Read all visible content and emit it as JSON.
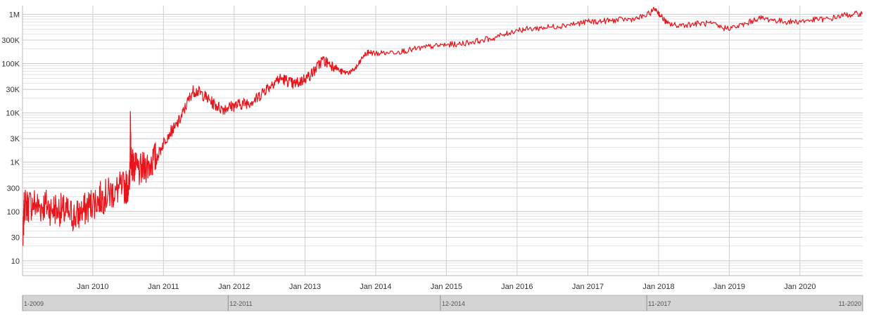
{
  "chart_data": {
    "type": "line",
    "title": "",
    "xlabel": "",
    "ylabel": "",
    "y_scale": "log",
    "ylim": [
      5,
      1500000
    ],
    "xlim": [
      "2009-01-03",
      "2020-11-20"
    ],
    "grid": true,
    "legend": "none",
    "y_ticks": [
      {
        "value": 10,
        "label": "10"
      },
      {
        "value": 30,
        "label": "30"
      },
      {
        "value": 100,
        "label": "100"
      },
      {
        "value": 300,
        "label": "300"
      },
      {
        "value": 1000,
        "label": "1K"
      },
      {
        "value": 3000,
        "label": "3K"
      },
      {
        "value": 10000,
        "label": "10K"
      },
      {
        "value": 30000,
        "label": "30K"
      },
      {
        "value": 100000,
        "label": "100K"
      },
      {
        "value": 300000,
        "label": "300K"
      },
      {
        "value": 1000000,
        "label": "1M"
      }
    ],
    "x_ticks": [
      {
        "date": "2010-01-01",
        "label": "Jan 2010"
      },
      {
        "date": "2011-01-01",
        "label": "Jan 2011"
      },
      {
        "date": "2012-01-01",
        "label": "Jan 2012"
      },
      {
        "date": "2013-01-01",
        "label": "Jan 2013"
      },
      {
        "date": "2014-01-01",
        "label": "Jan 2014"
      },
      {
        "date": "2015-01-01",
        "label": "Jan 2015"
      },
      {
        "date": "2016-01-01",
        "label": "Jan 2016"
      },
      {
        "date": "2017-01-01",
        "label": "Jan 2017"
      },
      {
        "date": "2018-01-01",
        "label": "Jan 2018"
      },
      {
        "date": "2019-01-01",
        "label": "Jan 2019"
      },
      {
        "date": "2020-01-01",
        "label": "Jan 2020"
      }
    ],
    "navigator_labels": [
      {
        "date": "2009-01-03",
        "label": "1-2009"
      },
      {
        "date": "2011-12-01",
        "label": "12-2011"
      },
      {
        "date": "2014-12-01",
        "label": "12-2014"
      },
      {
        "date": "2017-11-01",
        "label": "11-2017"
      },
      {
        "date": "2020-11-20",
        "label": "11-2020"
      }
    ],
    "series": [
      {
        "color": "#e8141b",
        "points": [
          [
            "2009-01-05",
            25
          ],
          [
            "2009-01-12",
            140
          ],
          [
            "2009-02-01",
            130
          ],
          [
            "2009-03-01",
            150
          ],
          [
            "2009-04-01",
            120
          ],
          [
            "2009-05-01",
            140
          ],
          [
            "2009-06-01",
            110
          ],
          [
            "2009-07-01",
            120
          ],
          [
            "2009-08-01",
            100
          ],
          [
            "2009-09-01",
            90
          ],
          [
            "2009-10-01",
            80
          ],
          [
            "2009-11-01",
            90
          ],
          [
            "2009-12-01",
            120
          ],
          [
            "2010-01-01",
            150
          ],
          [
            "2010-02-01",
            180
          ],
          [
            "2010-03-01",
            200
          ],
          [
            "2010-04-01",
            230
          ],
          [
            "2010-05-01",
            270
          ],
          [
            "2010-06-01",
            300
          ],
          [
            "2010-06-25",
            320
          ],
          [
            "2010-07-10",
            350
          ],
          [
            "2010-07-14",
            6000
          ],
          [
            "2010-07-17",
            1300
          ],
          [
            "2010-07-25",
            900
          ],
          [
            "2010-08-10",
            700
          ],
          [
            "2010-09-01",
            650
          ],
          [
            "2010-10-01",
            800
          ],
          [
            "2010-11-01",
            1000
          ],
          [
            "2010-12-01",
            1300
          ],
          [
            "2011-01-01",
            2500
          ],
          [
            "2011-02-01",
            4000
          ],
          [
            "2011-03-01",
            5000
          ],
          [
            "2011-04-01",
            8000
          ],
          [
            "2011-05-01",
            15000
          ],
          [
            "2011-06-01",
            28000
          ],
          [
            "2011-07-01",
            27000
          ],
          [
            "2011-08-01",
            22000
          ],
          [
            "2011-09-01",
            17000
          ],
          [
            "2011-10-01",
            14000
          ],
          [
            "2011-11-01",
            12000
          ],
          [
            "2011-12-01",
            13000
          ],
          [
            "2012-01-01",
            14000
          ],
          [
            "2012-02-01",
            15000
          ],
          [
            "2012-03-01",
            16000
          ],
          [
            "2012-04-01",
            17000
          ],
          [
            "2012-05-01",
            20000
          ],
          [
            "2012-06-01",
            28000
          ],
          [
            "2012-07-01",
            35000
          ],
          [
            "2012-08-01",
            45000
          ],
          [
            "2012-09-01",
            50000
          ],
          [
            "2012-10-01",
            45000
          ],
          [
            "2012-11-01",
            38000
          ],
          [
            "2012-12-01",
            42000
          ],
          [
            "2013-01-01",
            50000
          ],
          [
            "2013-02-01",
            60000
          ],
          [
            "2013-03-01",
            80000
          ],
          [
            "2013-04-01",
            120000
          ],
          [
            "2013-05-01",
            100000
          ],
          [
            "2013-06-01",
            90000
          ],
          [
            "2013-07-01",
            70000
          ],
          [
            "2013-08-01",
            65000
          ],
          [
            "2013-09-01",
            70000
          ],
          [
            "2013-10-01",
            90000
          ],
          [
            "2013-11-01",
            150000
          ],
          [
            "2013-12-01",
            170000
          ],
          [
            "2014-01-01",
            160000
          ],
          [
            "2014-03-01",
            170000
          ],
          [
            "2014-05-01",
            175000
          ],
          [
            "2014-07-01",
            190000
          ],
          [
            "2014-09-01",
            210000
          ],
          [
            "2014-11-01",
            230000
          ],
          [
            "2015-01-01",
            240000
          ],
          [
            "2015-03-01",
            250000
          ],
          [
            "2015-05-01",
            270000
          ],
          [
            "2015-07-01",
            300000
          ],
          [
            "2015-09-01",
            330000
          ],
          [
            "2015-11-01",
            400000
          ],
          [
            "2016-01-01",
            480000
          ],
          [
            "2016-03-01",
            500000
          ],
          [
            "2016-05-01",
            530000
          ],
          [
            "2016-07-01",
            560000
          ],
          [
            "2016-09-01",
            600000
          ],
          [
            "2016-11-01",
            650000
          ],
          [
            "2017-01-01",
            700000
          ],
          [
            "2017-03-01",
            720000
          ],
          [
            "2017-05-01",
            750000
          ],
          [
            "2017-07-01",
            780000
          ],
          [
            "2017-09-01",
            800000
          ],
          [
            "2017-11-01",
            950000
          ],
          [
            "2017-12-15",
            1300000
          ],
          [
            "2018-01-15",
            900000
          ],
          [
            "2018-02-15",
            650000
          ],
          [
            "2018-04-01",
            600000
          ],
          [
            "2018-06-01",
            620000
          ],
          [
            "2018-08-01",
            650000
          ],
          [
            "2018-10-01",
            650000
          ],
          [
            "2018-12-01",
            520000
          ],
          [
            "2019-02-01",
            550000
          ],
          [
            "2019-04-01",
            650000
          ],
          [
            "2019-06-01",
            850000
          ],
          [
            "2019-08-01",
            780000
          ],
          [
            "2019-10-01",
            720000
          ],
          [
            "2019-12-01",
            700000
          ],
          [
            "2020-02-01",
            750000
          ],
          [
            "2020-04-01",
            780000
          ],
          [
            "2020-06-01",
            800000
          ],
          [
            "2020-08-01",
            950000
          ],
          [
            "2020-10-01",
            1000000
          ],
          [
            "2020-11-20",
            1050000
          ]
        ]
      }
    ]
  }
}
